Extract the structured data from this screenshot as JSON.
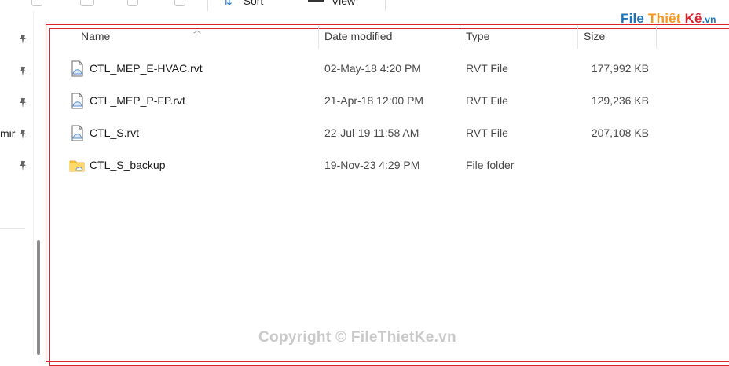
{
  "toolbar": {
    "sort_label": "Sort",
    "view_label": "View"
  },
  "nav": {
    "partial_text": "mir"
  },
  "columns": {
    "name": "Name",
    "date": "Date modified",
    "type": "Type",
    "size": "Size"
  },
  "files": [
    {
      "name": "CTL_MEP_E-HVAC.rvt",
      "date": "02-May-18 4:20 PM",
      "type": "RVT File",
      "size": "177,992 KB",
      "icon": "rvt-file-icon"
    },
    {
      "name": "CTL_MEP_P-FP.rvt",
      "date": "21-Apr-18 12:00 PM",
      "type": "RVT File",
      "size": "129,236 KB",
      "icon": "rvt-file-icon"
    },
    {
      "name": "CTL_S.rvt",
      "date": "22-Jul-19 11:58 AM",
      "type": "RVT File",
      "size": "207,108 KB",
      "icon": "rvt-file-icon"
    },
    {
      "name": "CTL_S_backup",
      "date": "19-Nov-23 4:29 PM",
      "type": "File folder",
      "size": "",
      "icon": "folder-icon"
    }
  ],
  "watermark": {
    "brand_part1": "File",
    "brand_part2": "Thiết",
    "brand_part3": "Kế",
    "brand_part4": ".vn",
    "copyright": "Copyright © FileThietKe.vn"
  },
  "colors": {
    "frame": "#e0242c",
    "folder": "#f5c342",
    "file_icon": "#5b8fd6",
    "brand_blue": "#1b75bc",
    "brand_orange": "#f39a1e",
    "brand_red": "#d8232a"
  }
}
